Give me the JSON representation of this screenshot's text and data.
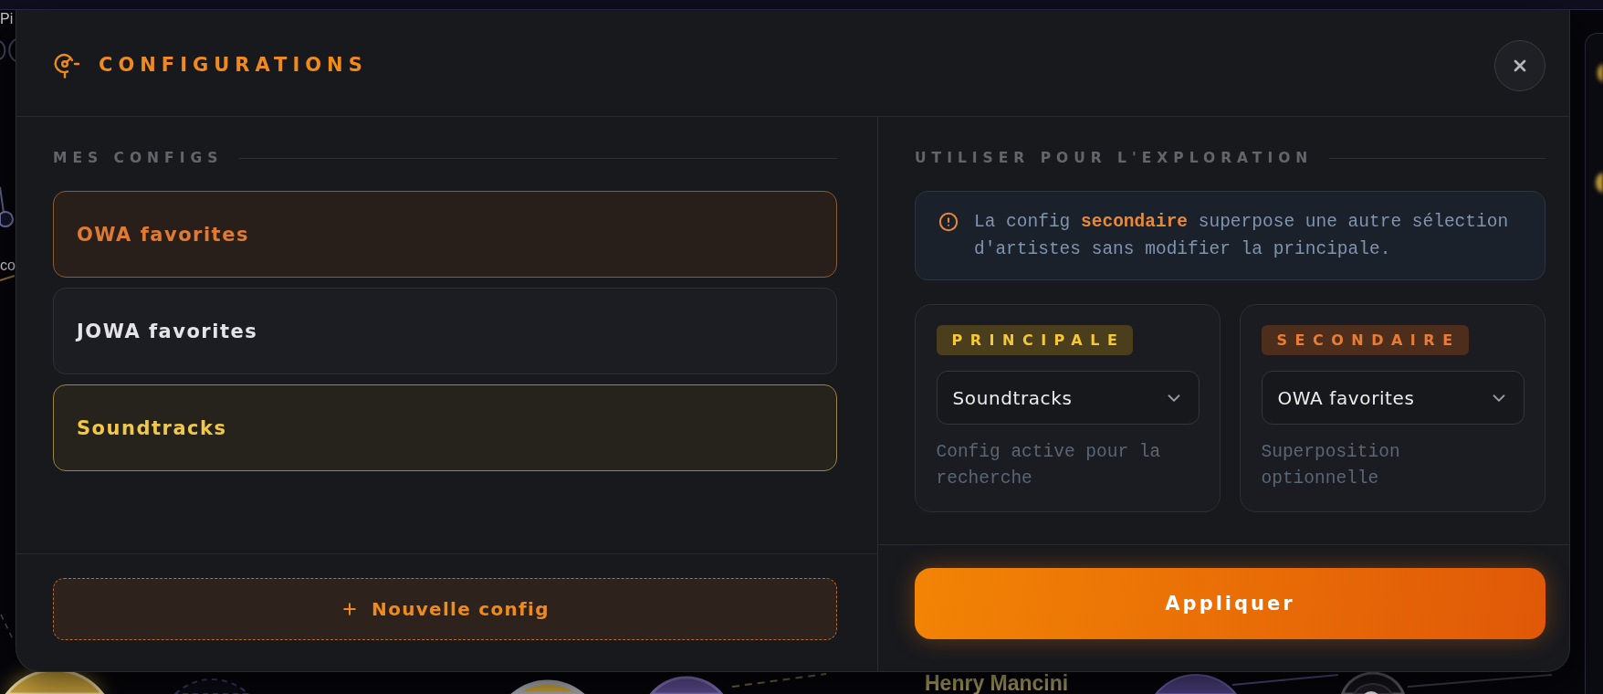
{
  "background_graph": {
    "labels": [
      {
        "text": "Pi"
      },
      {
        "text": "co"
      },
      {
        "text": "Henry Mancini"
      }
    ]
  },
  "dialog": {
    "title": "CONFIGURATIONS",
    "my_configs": {
      "heading": "MES CONFIGS",
      "items": [
        {
          "name": "OWA favorites",
          "primary": false,
          "secondary": true
        },
        {
          "name": "JOWA favorites",
          "primary": false,
          "secondary": false
        },
        {
          "name": "Soundtracks",
          "primary": true,
          "secondary": false
        }
      ],
      "new_button": "Nouvelle config"
    },
    "exploration": {
      "heading": "UTILISER POUR L'EXPLORATION",
      "info": "La config **secondaire** superpose une autre sélection d'artistes sans modifier la principale.",
      "slots": [
        {
          "kind": "primary",
          "badge": "PRINCIPALE",
          "value": "Soundtracks",
          "caption": "Config active pour la recherche"
        },
        {
          "kind": "secondary",
          "badge": "SECONDAIRE",
          "value": "OWA favorites",
          "caption": "Superposition optionnelle"
        }
      ],
      "apply_button": "Appliquer"
    }
  }
}
